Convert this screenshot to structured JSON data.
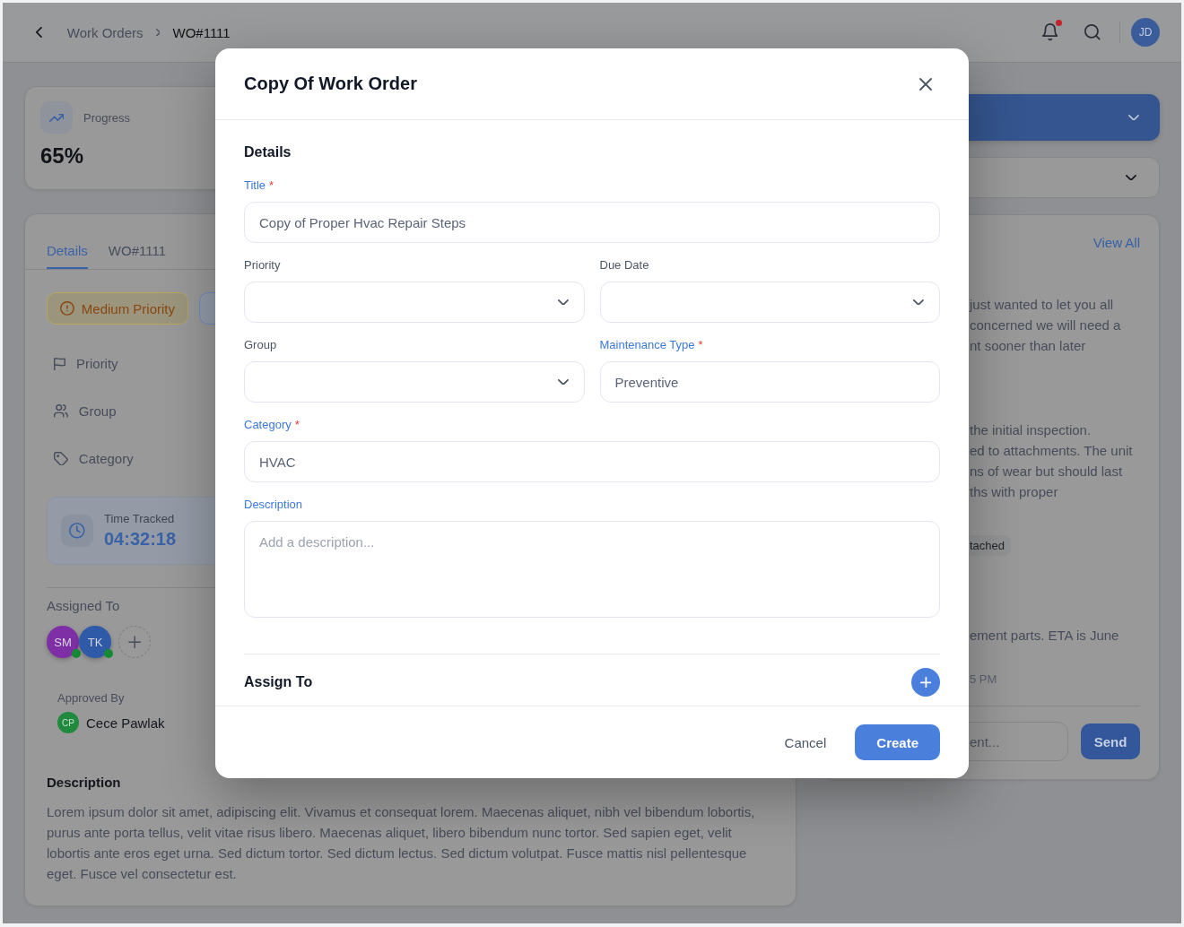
{
  "header": {
    "breadcrumbs": [
      {
        "label": "Work Orders",
        "current": false
      },
      {
        "label": "WO#1111",
        "current": true
      }
    ],
    "unread_notifications": true,
    "user_initials": "JD"
  },
  "progress": {
    "label": "Progress",
    "value": "65%"
  },
  "details_card": {
    "tabs": [
      {
        "label": "Details",
        "selected": true
      },
      {
        "label": "WO#1111",
        "selected": false
      }
    ],
    "badges": [
      {
        "kind": "priority",
        "label": "Medium Priority"
      },
      {
        "kind": "status"
      }
    ],
    "properties": [
      "Priority",
      "Group",
      "Category"
    ],
    "time_tracked": {
      "label": "Time Tracked",
      "value": "04:32:18"
    },
    "assigned": {
      "label": "Assigned To",
      "people": [
        {
          "initials": "SM",
          "color": "#7e2fa6",
          "online": true
        },
        {
          "initials": "TK",
          "color": "#2f5aa8",
          "online": true
        }
      ]
    },
    "approved": {
      "label": "Approved By",
      "initials": "CP",
      "name": "Cece Pawlak"
    },
    "description": {
      "heading": "Description",
      "text": "Lorem ipsum dolor sit amet, adipiscing elit. Vivamus et consequat lorem. Maecenas aliquet, nibh vel bibendum lobortis, purus ante porta tellus, velit vitae risus libero. Maecenas aliquet, libero bibendum nunc tortor. Sed sapien eget, velit lobortis ante eros eget urna. Sed dictum tortor. Sed dictum lectus. Sed dictum volutpat. Fusce mattis nisl pellentesque eget. Fusce vel consectetur est."
    }
  },
  "side_panel": {
    "view_all": "View All",
    "comments": [
      {
        "lines": [
          "just wanted to let you all",
          "concerned we will need a",
          "nt sooner than later"
        ]
      },
      {
        "lines": [
          "the initial inspection.",
          "ed to attachments. The unit",
          "ns of wear but should last",
          "ths with proper"
        ],
        "attachment": "tached"
      },
      {
        "lines": [
          "ement parts. ETA is June"
        ],
        "time": "5 PM"
      }
    ],
    "comment_field": {
      "placeholder": "ent..."
    },
    "send": "Send"
  },
  "modal": {
    "title": "Copy Of Work Order",
    "section": "Details",
    "rows": [
      [
        {
          "kind": "input",
          "label": "Title",
          "required_mark": "*",
          "highlighted": true,
          "value": "Copy of Proper Hvac Repair Steps"
        }
      ],
      [
        {
          "kind": "select",
          "label": "Priority",
          "highlighted": false
        },
        {
          "kind": "select",
          "label": "Due Date",
          "highlighted": false
        }
      ],
      [
        {
          "kind": "select",
          "label": "Group",
          "highlighted": false
        },
        {
          "kind": "input",
          "label": "Maintenance Type",
          "required_mark": "*",
          "highlighted": true,
          "value": "Preventive"
        }
      ],
      [
        {
          "kind": "input",
          "label": "Category",
          "required_mark": "*",
          "highlighted": true,
          "value": "HVAC"
        }
      ],
      [
        {
          "kind": "textarea",
          "label": "Description",
          "highlighted": true,
          "placeholder": "Add a description..."
        }
      ]
    ],
    "assign_heading": "Assign To",
    "buttons": [
      {
        "kind": "secondary",
        "label": "Cancel"
      },
      {
        "kind": "primary",
        "label": "Create"
      }
    ]
  }
}
